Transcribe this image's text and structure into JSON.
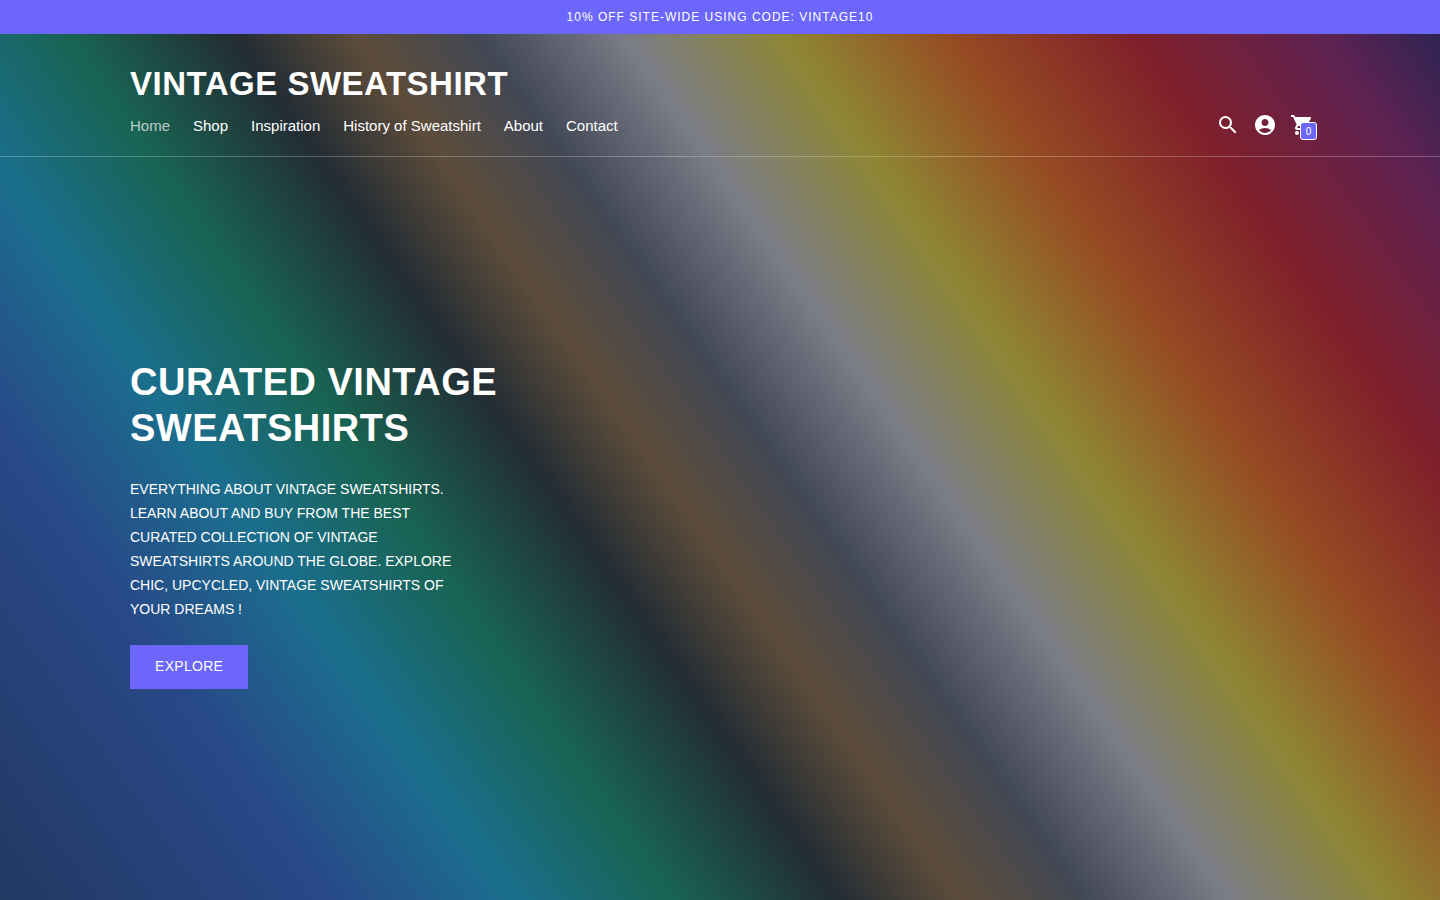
{
  "announcement": {
    "text": "10% OFF SITE-WIDE USING CODE: VINTAGE10"
  },
  "header": {
    "logo": "VINTAGE SWEATSHIRT",
    "nav": [
      {
        "label": "Home",
        "selected": true
      },
      {
        "label": "Shop",
        "selected": false
      },
      {
        "label": "Inspiration",
        "selected": false
      },
      {
        "label": "History of Sweatshirt",
        "selected": false
      },
      {
        "label": "About",
        "selected": false
      },
      {
        "label": "Contact",
        "selected": false
      }
    ],
    "cart_count": "0"
  },
  "hero": {
    "title": "CURATED VINTAGE SWEATSHIRTS",
    "description": "EVERYTHING ABOUT VINTAGE SWEATSHIRTS. LEARN ABOUT AND BUY FROM THE BEST CURATED COLLECTION OF VINTAGE SWEATSHIRTS AROUND THE GLOBE. EXPLORE CHIC, UPCYCLED, VINTAGE SWEATSHIRTS OF YOUR DREAMS !",
    "button": "EXPLORE"
  }
}
